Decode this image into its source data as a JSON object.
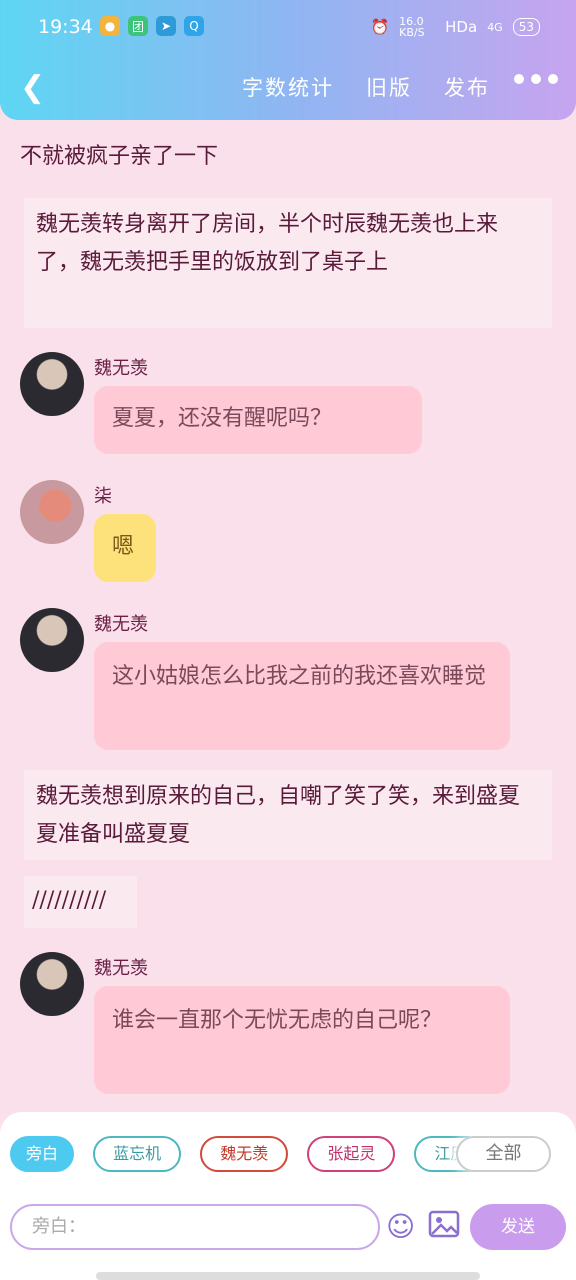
{
  "status": {
    "time": "19:34",
    "speed": "16.0 KB/S",
    "hd": "HDa",
    "signal": "4G",
    "battery": "53"
  },
  "nav": {
    "back_icon": "chevron-left-icon",
    "links": [
      "字数统计",
      "旧版",
      "发布"
    ],
    "more_icon": "more-dots-icon"
  },
  "narration": [
    "不就被疯子亲了一下",
    "魏无羡转身离开了房间，半个时辰魏无羡也上来了，魏无羡把手里的饭放到了桌子上",
    "魏无羡想到原来的自己，自嘲了笑了笑，来到盛夏夏准备叫盛夏夏",
    "//////////"
  ],
  "messages": [
    {
      "name": "魏无羡",
      "text": "夏夏，还没有醒呢吗？"
    },
    {
      "name": "柒",
      "text": "嗯"
    },
    {
      "name": "魏无羡",
      "text": "这小姑娘怎么比我之前的我还喜欢睡觉"
    },
    {
      "name": "魏无羡",
      "text": "谁会一直那个无忧无虑的自己呢？"
    }
  ],
  "roles": [
    {
      "label": "旁白",
      "color": "#4ec9ef"
    },
    {
      "label": "蓝忘机",
      "color": "#4cb8c0"
    },
    {
      "label": "魏无羡",
      "color": "#d24a3a"
    },
    {
      "label": "张起灵",
      "color": "#d0407a"
    },
    {
      "label": "江厌",
      "color": "#4cb8c0"
    }
  ],
  "all_label": "全部",
  "input_placeholder": "旁白：",
  "send_label": "发送",
  "emoji_icon": "emoji-icon",
  "image_icon": "image-icon"
}
